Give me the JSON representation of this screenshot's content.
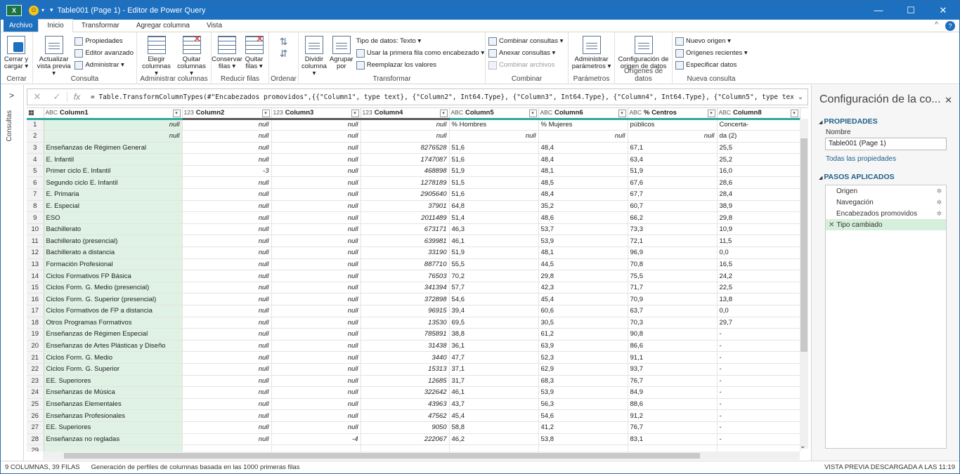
{
  "window": {
    "app_badge": "X",
    "title": "Table001 (Page 1) - Editor de Power Query",
    "minimize": "—",
    "maximize": "☐",
    "close": "✕"
  },
  "menu": {
    "file": "Archivo",
    "tabs": [
      "Inicio",
      "Transformar",
      "Agregar columna",
      "Vista"
    ],
    "chevron": "^",
    "help": "?"
  },
  "ribbon": {
    "cerrar": {
      "btn": "Cerrar y cargar ▾",
      "group": "Cerrar"
    },
    "consulta": {
      "actualizar": "Actualizar vista previa ▾",
      "propiedades": "Propiedades",
      "editor": "Editor avanzado",
      "administrar": "Administrar ▾",
      "group": "Consulta"
    },
    "admincols": {
      "elegir": "Elegir columnas ▾",
      "quitar": "Quitar columnas ▾",
      "group": "Administrar columnas"
    },
    "reducir": {
      "conservar": "Conservar filas ▾",
      "quitar": "Quitar filas ▾",
      "group": "Reducir filas"
    },
    "ordenar": {
      "group": "Ordenar"
    },
    "transformar": {
      "dividir": "Dividir columna ▾",
      "agrupar": "Agrupar por",
      "tipo": "Tipo de datos: Texto ▾",
      "primera": "Usar la primera fila como encabezado ▾",
      "reemplazar": "Reemplazar los valores",
      "group": "Transformar"
    },
    "combinar": {
      "combinar": "Combinar consultas ▾",
      "anexar": "Anexar consultas ▾",
      "archivos": "Combinar archivos",
      "group": "Combinar"
    },
    "parametros": {
      "admin": "Administrar parámetros ▾",
      "group": "Parámetros"
    },
    "origenes": {
      "config": "Configuración de origen de datos",
      "group": "Orígenes de datos"
    },
    "nueva": {
      "nuevo": "Nuevo origen ▾",
      "recientes": "Orígenes recientes ▾",
      "especificar": "Especificar datos",
      "group": "Nueva consulta"
    }
  },
  "leftnav": {
    "chevron": ">",
    "label": "Consultas"
  },
  "formula": {
    "cancel": "✕",
    "confirm": "✓",
    "fx": "fx",
    "text": "= Table.TransformColumnTypes(#\"Encabezados promovidos\",{{\"Column1\", type text}, {\"Column2\", Int64.Type}, {\"Column3\", Int64.Type}, {\"Column4\", Int64.Type}, {\"Column5\", type text},",
    "dropdown": "⌄"
  },
  "grid": {
    "columns": [
      {
        "name": "Column1",
        "type": "ABC"
      },
      {
        "name": "Column2",
        "type": "123"
      },
      {
        "name": "Column3",
        "type": "123"
      },
      {
        "name": "Column4",
        "type": "123"
      },
      {
        "name": "Column5",
        "type": "ABC"
      },
      {
        "name": "Column6",
        "type": "ABC"
      },
      {
        "name": "% Centros",
        "type": "ABC"
      },
      {
        "name": "Column8",
        "type": "ABC"
      }
    ],
    "rows": [
      [
        "1",
        "null",
        "null",
        "null",
        "null",
        "% Hombres",
        "% Mujeres",
        "públicos",
        "Concerta-"
      ],
      [
        "2",
        "null",
        "null",
        "null",
        "null",
        "null",
        "null",
        "null",
        "da (2)"
      ],
      [
        "3",
        "Enseñanzas de Régimen General",
        "null",
        "null",
        "8276528",
        "51,6",
        "48,4",
        "67,1",
        "25,5"
      ],
      [
        "4",
        "E. Infantil",
        "null",
        "null",
        "1747087",
        "51,6",
        "48,4",
        "63,4",
        "25,2"
      ],
      [
        "5",
        "Primer ciclo E. Infantil",
        "-3",
        "null",
        "468898",
        "51,9",
        "48,1",
        "51,9",
        "16,0"
      ],
      [
        "6",
        "Segundo ciclo E. Infantil",
        "null",
        "null",
        "1278189",
        "51,5",
        "48,5",
        "67,6",
        "28,6"
      ],
      [
        "7",
        "E. Primaria",
        "null",
        "null",
        "2905640",
        "51,6",
        "48,4",
        "67,7",
        "28,4"
      ],
      [
        "8",
        "E. Especial",
        "null",
        "null",
        "37901",
        "64,8",
        "35,2",
        "60,7",
        "38,9"
      ],
      [
        "9",
        "ESO",
        "null",
        "null",
        "2011489",
        "51,4",
        "48,6",
        "66,2",
        "29,8"
      ],
      [
        "10",
        "Bachillerato",
        "null",
        "null",
        "673171",
        "46,3",
        "53,7",
        "73,3",
        "10,9"
      ],
      [
        "11",
        "Bachillerato (presencial)",
        "null",
        "null",
        "639981",
        "46,1",
        "53,9",
        "72,1",
        "11,5"
      ],
      [
        "12",
        "Bachillerato a distancia",
        "null",
        "null",
        "33190",
        "51,9",
        "48,1",
        "96,9",
        "0,0"
      ],
      [
        "13",
        "Formación Profesional",
        "null",
        "null",
        "887710",
        "55,5",
        "44,5",
        "70,8",
        "16,5"
      ],
      [
        "14",
        "Ciclos Formativos FP Básica",
        "null",
        "null",
        "76503",
        "70,2",
        "29,8",
        "75,5",
        "24,2"
      ],
      [
        "15",
        "Ciclos Form. G. Medio (presencial)",
        "null",
        "null",
        "341394",
        "57,7",
        "42,3",
        "71,7",
        "22,5"
      ],
      [
        "16",
        "Ciclos Form. G. Superior (presencial)",
        "null",
        "null",
        "372898",
        "54,6",
        "45,4",
        "70,9",
        "13,8"
      ],
      [
        "17",
        "Ciclos Formativos de FP a distancia",
        "null",
        "null",
        "96915",
        "39,4",
        "60,6",
        "63,7",
        "0,0"
      ],
      [
        "18",
        "Otros Programas Formativos",
        "null",
        "null",
        "13530",
        "69,5",
        "30,5",
        "70,3",
        "29,7"
      ],
      [
        "19",
        "Enseñanzas de Régimen Especial",
        "null",
        "null",
        "785891",
        "38,8",
        "61,2",
        "90,8",
        "-"
      ],
      [
        "20",
        "Enseñanzas de Artes Plásticas y Diseño",
        "null",
        "null",
        "31438",
        "36,1",
        "63,9",
        "86,6",
        "-"
      ],
      [
        "21",
        "Ciclos Form. G. Medio",
        "null",
        "null",
        "3440",
        "47,7",
        "52,3",
        "91,1",
        "-"
      ],
      [
        "22",
        "Ciclos Form. G. Superior",
        "null",
        "null",
        "15313",
        "37,1",
        "62,9",
        "93,7",
        "-"
      ],
      [
        "23",
        "EE. Superiores",
        "null",
        "null",
        "12685",
        "31,7",
        "68,3",
        "76,7",
        "-"
      ],
      [
        "24",
        "Enseñanzas de Música",
        "null",
        "null",
        "322642",
        "46,1",
        "53,9",
        "84,9",
        "-"
      ],
      [
        "25",
        "Enseñanzas Elementales",
        "null",
        "null",
        "43963",
        "43,7",
        "56,3",
        "88,6",
        "-"
      ],
      [
        "26",
        "Enseñanzas Profesionales",
        "null",
        "null",
        "47562",
        "45,4",
        "54,6",
        "91,2",
        "-"
      ],
      [
        "27",
        "EE. Superiores",
        "null",
        "null",
        "9050",
        "58,8",
        "41,2",
        "76,7",
        "-"
      ],
      [
        "28",
        "Enseñanzas no regladas",
        "null",
        "-4",
        "222067",
        "46,2",
        "53,8",
        "83,1",
        "-"
      ],
      [
        "29",
        "",
        "",
        "",
        "",
        "",
        "",
        "",
        ""
      ]
    ]
  },
  "pane": {
    "title": "Configuración de la co...",
    "close": "✕",
    "props_header": "PROPIEDADES",
    "name_label": "Nombre",
    "name_value": "Table001 (Page 1)",
    "all_props": "Todas las propiedades",
    "steps_header": "PASOS APLICADOS",
    "steps": [
      "Origen",
      "Navegación",
      "Encabezados promovidos",
      "Tipo cambiado"
    ],
    "gear": "✲",
    "step_x": "✕"
  },
  "status": {
    "cols_rows": "9 COLUMNAS, 39 FILAS",
    "profiling": "Generación de perfiles de columnas basada en las 1000 primeras filas",
    "preview": "VISTA PREVIA DESCARGADA A LAS 11:19"
  }
}
